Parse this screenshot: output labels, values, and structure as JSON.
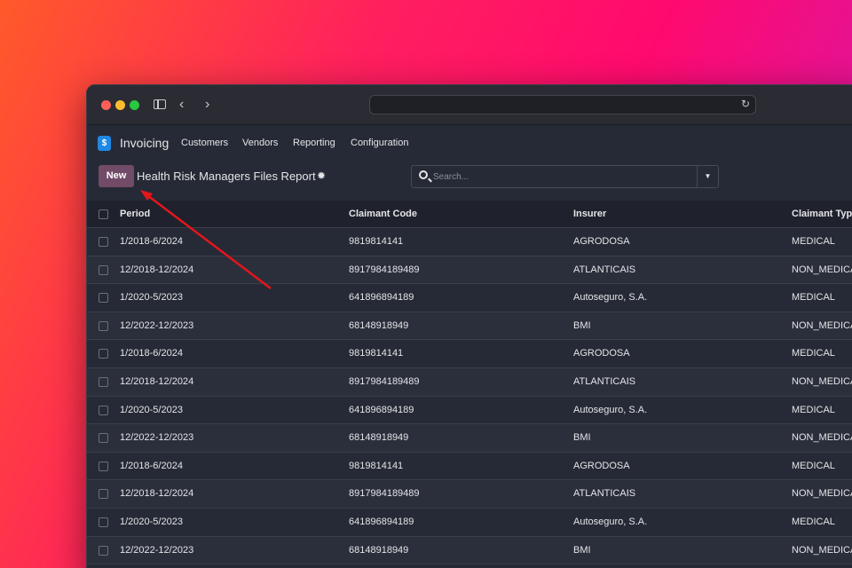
{
  "app": {
    "name": "Invoicing",
    "menu": [
      "Customers",
      "Vendors",
      "Reporting",
      "Configuration"
    ]
  },
  "control": {
    "new_label": "New",
    "title": "Health Risk Managers Files Report",
    "search_placeholder": "Search..."
  },
  "table": {
    "columns": [
      "Period",
      "Claimant Code",
      "Insurer",
      "Claimant Type"
    ],
    "rows": [
      [
        "1/2018-6/2024",
        "9819814141",
        "AGRODOSA",
        "MEDICAL"
      ],
      [
        "12/2018-12/2024",
        "8917984189489",
        "ATLANTICAIS",
        "NON_MEDICA"
      ],
      [
        "1/2020-5/2023",
        "641896894189",
        "Autoseguro, S.A.",
        "MEDICAL"
      ],
      [
        "12/2022-12/2023",
        "68148918949",
        "BMI",
        "NON_MEDICA"
      ],
      [
        "1/2018-6/2024",
        "9819814141",
        "AGRODOSA",
        "MEDICAL"
      ],
      [
        "12/2018-12/2024",
        "8917984189489",
        "ATLANTICAIS",
        "NON_MEDICA"
      ],
      [
        "1/2020-5/2023",
        "641896894189",
        "Autoseguro, S.A.",
        "MEDICAL"
      ],
      [
        "12/2022-12/2023",
        "68148918949",
        "BMI",
        "NON_MEDICA"
      ],
      [
        "1/2018-6/2024",
        "9819814141",
        "AGRODOSA",
        "MEDICAL"
      ],
      [
        "12/2018-12/2024",
        "8917984189489",
        "ATLANTICAIS",
        "NON_MEDICA"
      ],
      [
        "1/2020-5/2023",
        "641896894189",
        "Autoseguro, S.A.",
        "MEDICAL"
      ],
      [
        "12/2022-12/2023",
        "68148918949",
        "BMI",
        "NON_MEDICA"
      ]
    ]
  },
  "colors": {
    "accent": "#714b67",
    "annotation_arrow": "#e3161c"
  }
}
